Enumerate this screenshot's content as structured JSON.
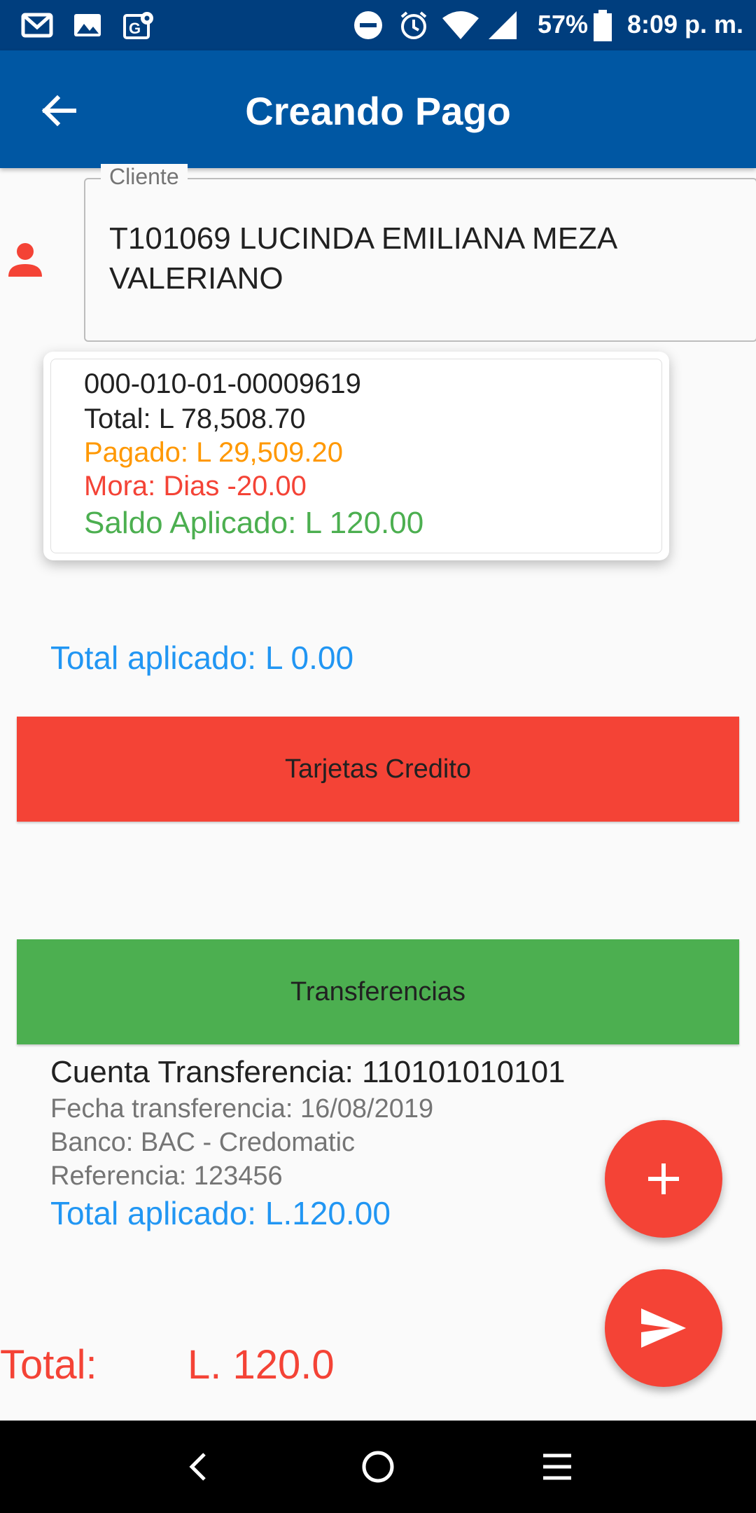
{
  "status_bar": {
    "battery": "57%",
    "time": "8:09 p. m.",
    "icons": [
      "gmail-icon",
      "gallery-icon",
      "maps-icon",
      "dnd-icon",
      "alarm-icon",
      "wifi-icon",
      "signal-icon",
      "battery-icon"
    ]
  },
  "app_bar": {
    "title": "Creando Pago",
    "back_icon": "arrow-back-icon"
  },
  "client": {
    "label": "Cliente",
    "value": "T101069 LUCINDA EMILIANA MEZA VALERIANO",
    "icon": "person-icon"
  },
  "invoice": {
    "number": "000-010-01-00009619",
    "total": "Total: L 78,508.70",
    "pagado": "Pagado: L 29,509.20",
    "mora": "Mora: Dias -20.00",
    "saldo": "Saldo Aplicado: L 120.00"
  },
  "total_aplicado": "Total aplicado: L 0.00",
  "sections": {
    "tarjetas": "Tarjetas Credito",
    "transferencias": "Transferencias"
  },
  "transfer": {
    "cuenta": "Cuenta Transferencia: 110101010101",
    "fecha": "Fecha transferencia: 16/08/2019",
    "banco": "Banco: BAC - Credomatic",
    "referencia": "Referencia: 123456",
    "total": "Total aplicado: L.120.00"
  },
  "fabs": {
    "add_icon": "plus-icon",
    "send_icon": "send-icon"
  },
  "grand_total": {
    "label": "Total:",
    "value": "L. 120.0"
  },
  "nav": [
    "back-nav-icon",
    "home-nav-icon",
    "menu-nav-icon"
  ],
  "colors": {
    "status_bar": "#003e7e",
    "app_bar": "#0057a3",
    "blue_text": "#2196f3",
    "red": "#f44336",
    "green": "#4caf50",
    "orange": "#ff9800"
  }
}
